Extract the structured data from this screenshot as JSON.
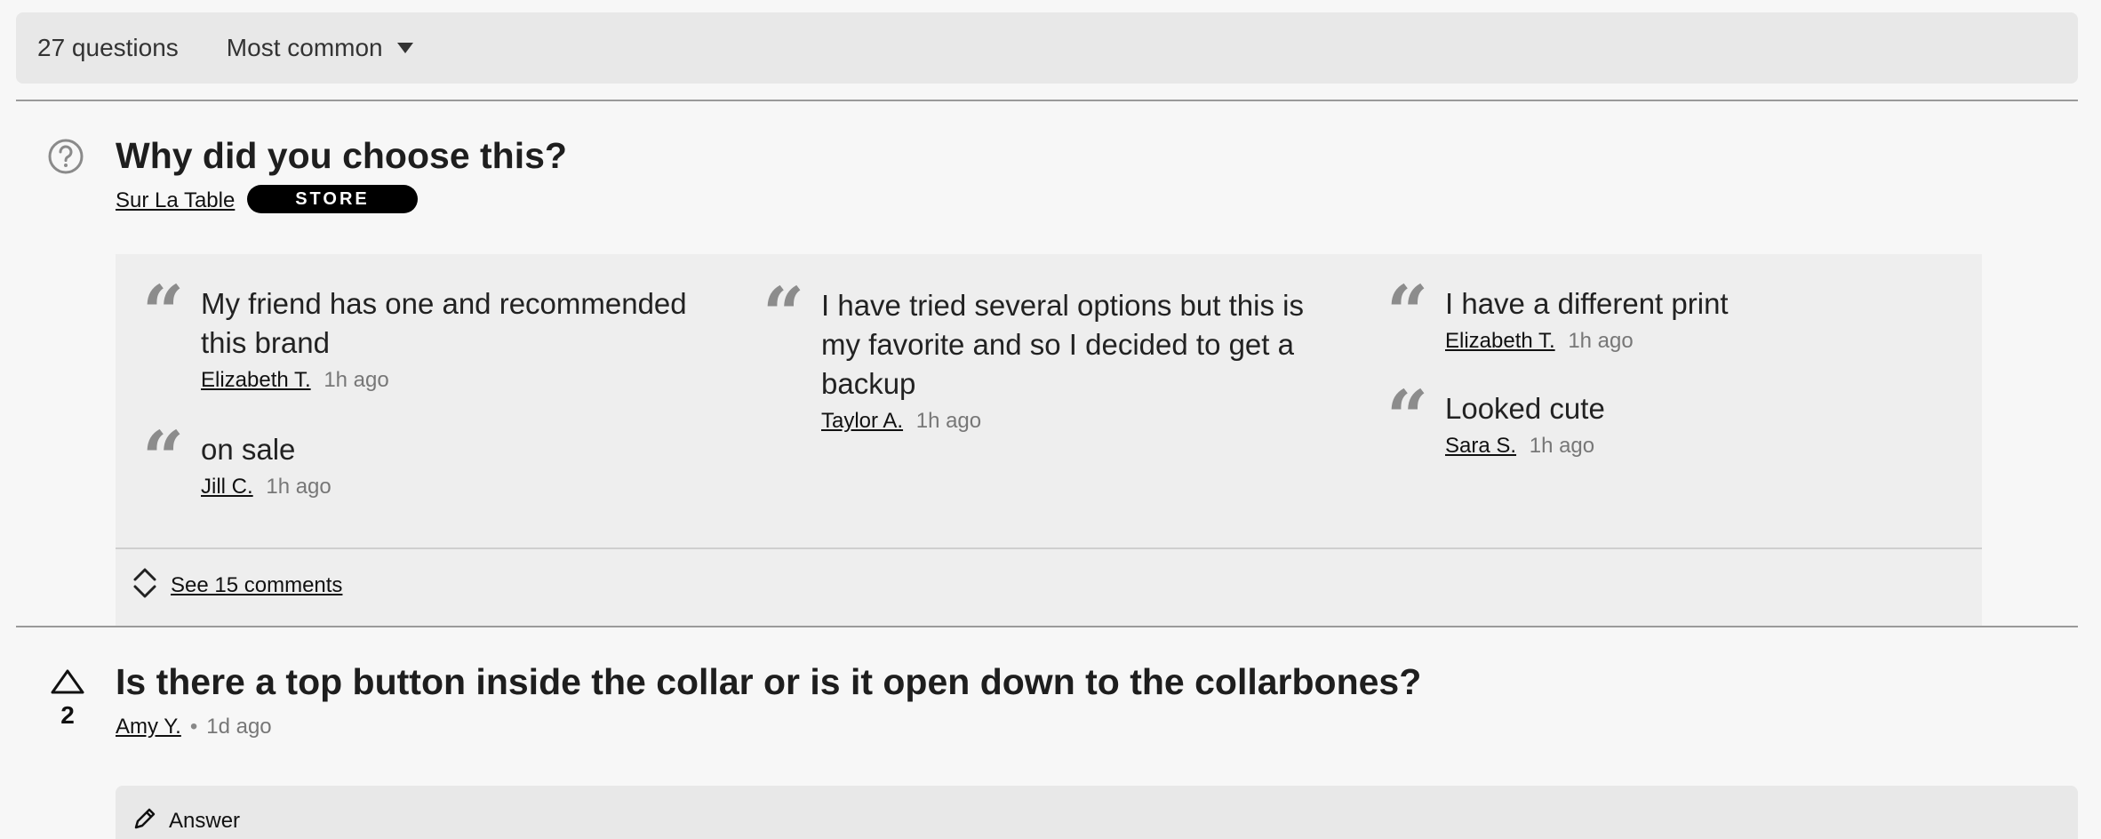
{
  "toolbar": {
    "count_label": "27 questions",
    "sort_label": "Most common"
  },
  "question1": {
    "title": "Why did you choose this?",
    "store_name": "Sur La Table",
    "badge": "STORE",
    "answers": [
      {
        "text": "My friend has one and recommended this brand",
        "author": "Elizabeth T.",
        "time": "1h ago"
      },
      {
        "text": "on sale",
        "author": "Jill C.",
        "time": "1h ago"
      },
      {
        "text": "I have tried several options but this is my favorite and so I decided to get a backup",
        "author": "Taylor A.",
        "time": "1h ago"
      },
      {
        "text": "I have a different print",
        "author": "Elizabeth T.",
        "time": "1h ago"
      },
      {
        "text": "Looked cute",
        "author": "Sara S.",
        "time": "1h ago"
      }
    ],
    "see_comments": "See 15 comments"
  },
  "question2": {
    "votes": "2",
    "title": "Is there a top button inside the collar or is it open down to the collarbones?",
    "author": "Amy Y.",
    "separator": "•",
    "time": "1d ago",
    "answer_button": "Answer"
  },
  "icons": {
    "question": "question-circle-icon",
    "quote": "quote-icon",
    "sort": "caret-down-icon",
    "expand": "expand-chevrons-icon",
    "upvote": "upvote-triangle-icon",
    "answer": "pencil-icon"
  }
}
